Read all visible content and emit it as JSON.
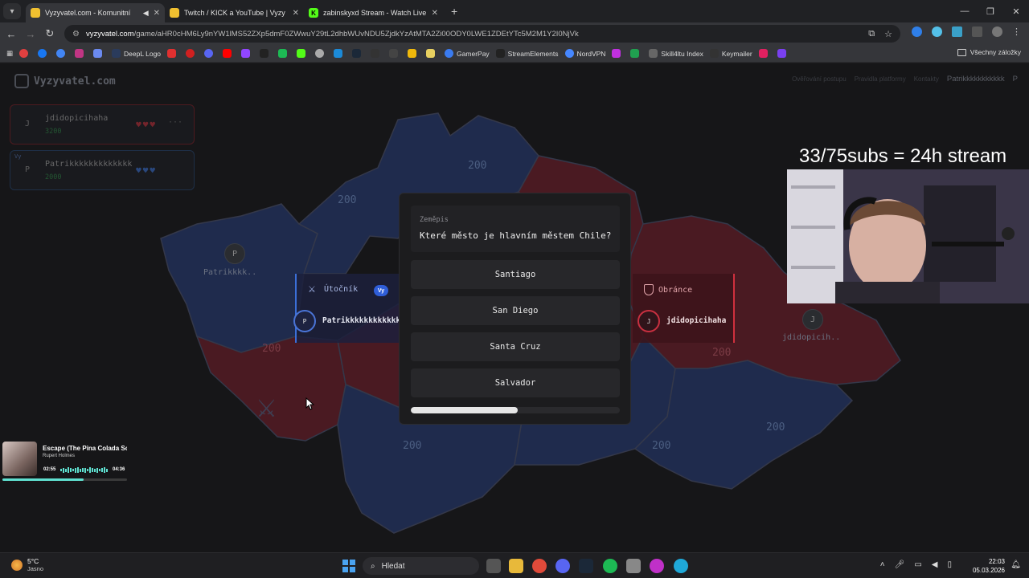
{
  "browser": {
    "tabs": [
      {
        "title": "Vyzyvatel.com - Komunitní",
        "active": true,
        "fav_color": "#f0c030"
      },
      {
        "title": "Twitch / KICK a YouTube | Vyzy",
        "active": false,
        "fav_color": "#f0c030"
      },
      {
        "title": "zabinskyxd Stream - Watch Live",
        "active": false,
        "fav_color": "#53fc18"
      }
    ],
    "url_host": "vyzyvatel.com",
    "url_path": "/game/aHR0cHM6Ly9nYW1lMS52ZXp5dmF0ZWwuY29tL2dhbWUvNDU5ZjdkYzAtMTA2Zi00ODY0LWE1ZDEtYTc5M2M1Y2I0NjVk",
    "bookmarks": [
      "DeepL Logo",
      "GamerPay",
      "StreamElements",
      "NordVPN",
      "Skill4ltu Index",
      "Keymailer"
    ],
    "bookmarks_all": "Všechny záložky"
  },
  "site": {
    "logo": "Vyzyvatel.com",
    "nav": [
      "Ověřování postupu",
      "Pravidla platformy",
      "Kontakty"
    ],
    "user_name": "Patrikkkkkkkkkkk",
    "user_initial": "P"
  },
  "players": [
    {
      "initial": "J",
      "name": "jdidopicihaha",
      "score": "3200",
      "hearts": "♥♥♥",
      "color": "#c0303c",
      "more": "···"
    },
    {
      "initial": "P",
      "name": "Patrikkkkkkkkkkkkk",
      "score": "2000",
      "hearts": "♥♥♥",
      "color": "#3a6fd0",
      "badge": "Vy"
    }
  ],
  "map": {
    "region_value": "200",
    "token_left_name": "Patrikkkk..",
    "token_left_initial": "P",
    "token_right_name": "jdidopicih..",
    "token_right_initial": "J",
    "colors": {
      "blue": "#1f2b4d",
      "red": "#4a1a22",
      "border": "#34384a"
    }
  },
  "attacker": {
    "label": "Útočník",
    "badge": "Vy",
    "initial": "P",
    "name": "Patrikkkkkkkkkkkkk"
  },
  "defender": {
    "label": "Obránce",
    "initial": "J",
    "name": "jdidopicihaha"
  },
  "question": {
    "category": "Zeměpis",
    "text": "Které město je hlavním městem Chile?",
    "answers": [
      "Santiago",
      "San Diego",
      "Santa Cruz",
      "Salvador"
    ],
    "time_remaining_fraction": 0.51
  },
  "stream": {
    "overlay_text": "33/75subs = 24h stream",
    "music": {
      "song": "Escape (The Pina Colada Song)",
      "artist": "Rupert Holmes",
      "current": "02:55",
      "total": "04:36",
      "progress": 0.65
    }
  },
  "taskbar": {
    "temp": "5°C",
    "weather": "Jasno",
    "search": "Hledat",
    "time": "22:03",
    "date": "05.03.2026"
  }
}
